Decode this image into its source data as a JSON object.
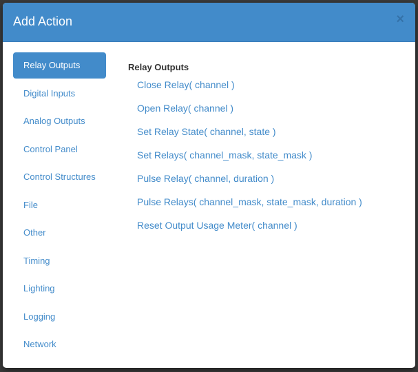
{
  "dialog": {
    "title": "Add Action",
    "close_label": "×"
  },
  "sidebar": {
    "items": [
      {
        "label": "Relay Outputs",
        "active": true
      },
      {
        "label": "Digital Inputs"
      },
      {
        "label": "Analog Outputs"
      },
      {
        "label": "Control Panel"
      },
      {
        "label": "Control Structures"
      },
      {
        "label": "File"
      },
      {
        "label": "Other"
      },
      {
        "label": "Timing"
      },
      {
        "label": "Lighting"
      },
      {
        "label": "Logging"
      },
      {
        "label": "Network"
      }
    ]
  },
  "content": {
    "heading": "Relay Outputs",
    "actions": [
      "Close Relay( channel )",
      "Open Relay( channel )",
      "Set Relay State( channel, state )",
      "Set Relays( channel_mask, state_mask )",
      "Pulse Relay( channel, duration )",
      "Pulse Relays( channel_mask, state_mask, duration )",
      "Reset Output Usage Meter( channel )"
    ]
  },
  "colors": {
    "accent": "#428bca",
    "backdrop": "#3a3a3a",
    "heading_text": "#333333"
  }
}
